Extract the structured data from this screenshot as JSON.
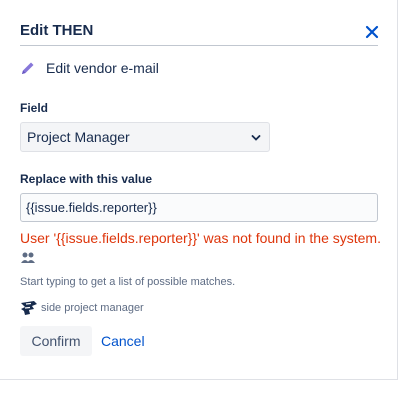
{
  "dialog": {
    "title": "Edit THEN",
    "subtitle": "Edit vendor e-mail",
    "close_icon": "close-icon",
    "subtitle_icon": "pencil-icon"
  },
  "form": {
    "field_label": "Field",
    "field_value": "Project Manager",
    "replace_label": "Replace with this value",
    "replace_value": "{{issue.fields.reporter}}",
    "error_text": "User '{{issue.fields.reporter}}' was not found in the system.",
    "hint_text": "Start typing to get a list of possible matches.",
    "suggestion": "side project manager"
  },
  "buttons": {
    "confirm": "Confirm",
    "cancel": "Cancel"
  },
  "colors": {
    "accent": "#0052cc",
    "error": "#de350b",
    "text": "#172b4d",
    "pencil": "#8777d9"
  }
}
